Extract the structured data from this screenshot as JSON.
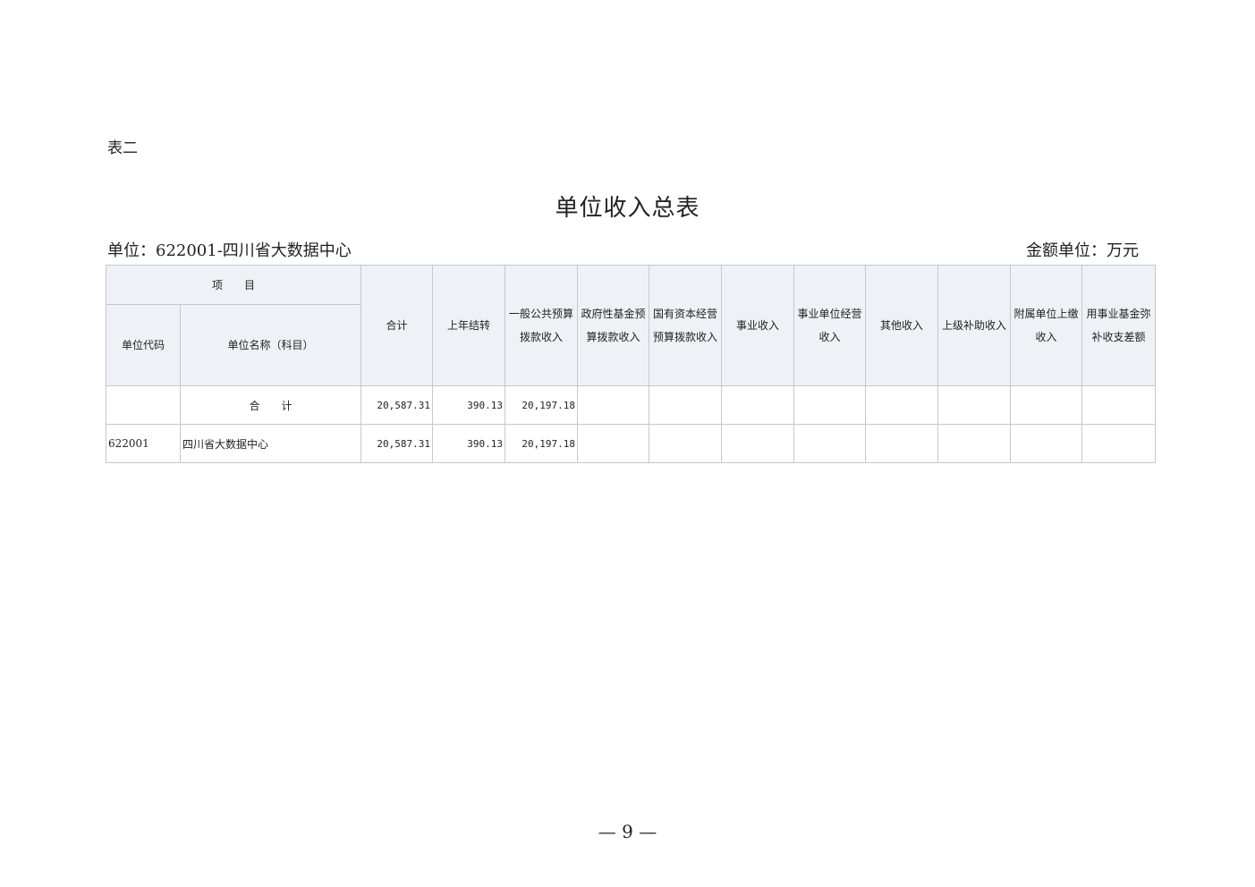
{
  "table_number": "表二",
  "title": "单位收入总表",
  "unit_line": "单位：622001-四川省大数据中心",
  "amount_unit": "金额单位：万元",
  "headers": {
    "project": "项　　目",
    "unit_code": "单位代码",
    "unit_name": "单位名称（科目）",
    "columns": [
      "合计",
      "上年结转",
      "一般公共预算拨款收入",
      "政府性基金预算拨款收入",
      "国有资本经营预算拨款收入",
      "事业收入",
      "事业单位经营收入",
      "其他收入",
      "上级补助收入",
      "附属单位上缴收入",
      "用事业基金弥补收支差额"
    ]
  },
  "rows": [
    {
      "code": "",
      "name": "合　　计",
      "values": [
        "20,587.31",
        "390.13",
        "20,197.18",
        "",
        "",
        "",
        "",
        "",
        "",
        "",
        ""
      ]
    },
    {
      "code": "622001",
      "name": "四川省大数据中心",
      "values": [
        "20,587.31",
        "390.13",
        "20,197.18",
        "",
        "",
        "",
        "",
        "",
        "",
        "",
        ""
      ]
    }
  ],
  "page_number": "— 9 —"
}
